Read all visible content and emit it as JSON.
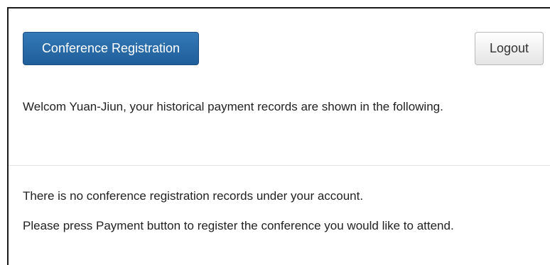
{
  "header": {
    "registration_button_label": "Conference Registration",
    "logout_button_label": "Logout",
    "welcome_text": "Welcom Yuan-Jiun, your historical payment records are shown in the following."
  },
  "content": {
    "no_records_text": "There is no conference registration records under your account.",
    "instruction_text": "Please press Payment button to register the conference you would like to attend."
  },
  "colors": {
    "primary_button": "#2a6aa8",
    "default_button": "#f2f2f2",
    "text": "#222222",
    "divider": "#e3e3e3"
  }
}
